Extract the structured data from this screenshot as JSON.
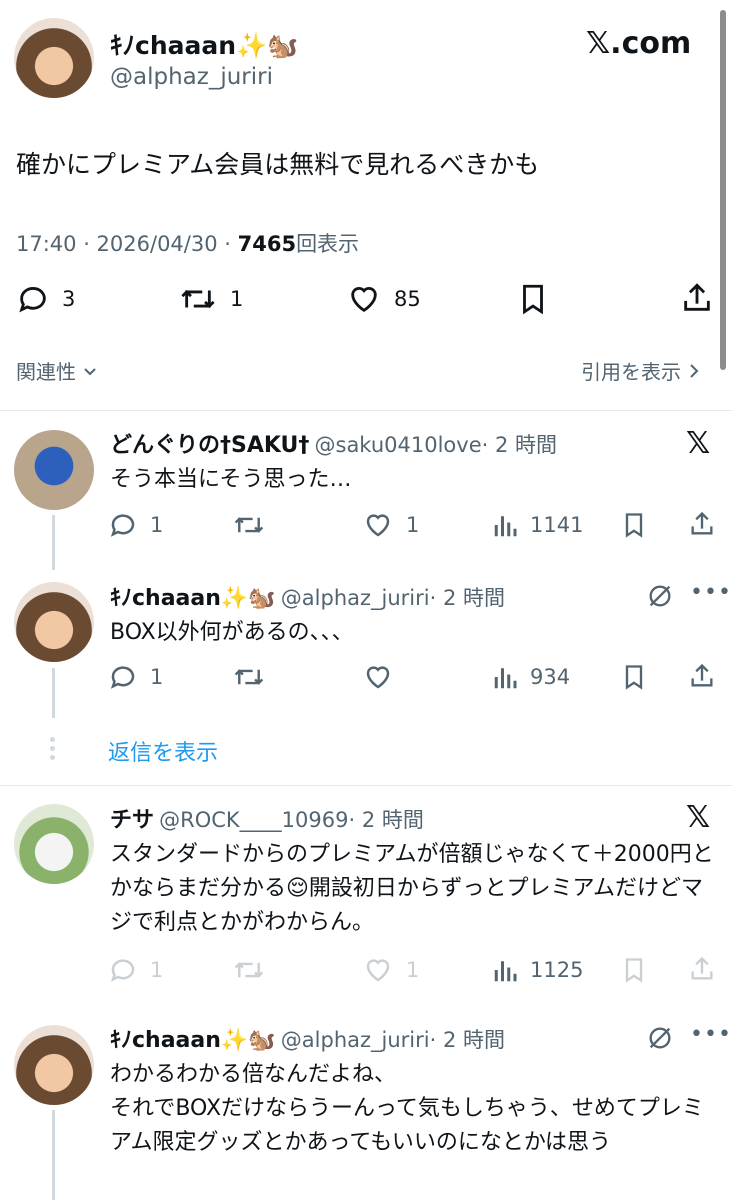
{
  "tweet": {
    "name": "ｷﾉchaaan",
    "name_emoji": "✨🐿️",
    "handle": "@alphaz_juriri",
    "site": "𝕏.com",
    "text": "確かにプレミアム会員は無料で見れるべきかも",
    "time": "17:40 · 2026/04/30 · ",
    "views": "7465",
    "views_label": "回表示",
    "replies": "3",
    "retweets": "1",
    "likes": "85"
  },
  "sort": {
    "label": "関連性",
    "quotes_link": "引用を表示"
  },
  "replies": [
    {
      "name": "どんぐりの†SAKU†",
      "handle": "@saku0410love",
      "time": "· 2 時間",
      "text": "そう本当にそう思った…",
      "replies": "1",
      "retweets": "",
      "likes": "1",
      "views": "1141"
    },
    {
      "name": "ｷﾉchaaan",
      "name_emoji": "✨🐿️",
      "handle": "@alphaz_juriri",
      "time": "· 2 時間",
      "text": "BOX以外何があるの、、、",
      "replies": "1",
      "retweets": "",
      "likes": "",
      "views": "934"
    },
    {
      "show_replies": "返信を表示"
    },
    {
      "name": "チサ",
      "handle": "@ROCK____10969",
      "time": "· 2 時間",
      "text": "スタンダードからのプレミアムが倍額じゃなくて＋2000円とかならまだ分かる😌開設初日からずっとプレミアムだけどマジで利点とかがわからん。",
      "replies": "1",
      "retweets": "",
      "likes": "1",
      "views": "1125"
    },
    {
      "name": "ｷﾉchaaan",
      "name_emoji": "✨🐿️",
      "handle": "@alphaz_juriri",
      "time": "· 2 時間",
      "text_lines": [
        "わかるわかる倍なんだよね、",
        "それでBOXだけならうーんって気もしちゃう、せめてプレミアム限定グッズとかあってもいいのになとかは思う"
      ]
    }
  ],
  "colors": {
    "link": "#1d9bf0",
    "muted": "#536471"
  }
}
